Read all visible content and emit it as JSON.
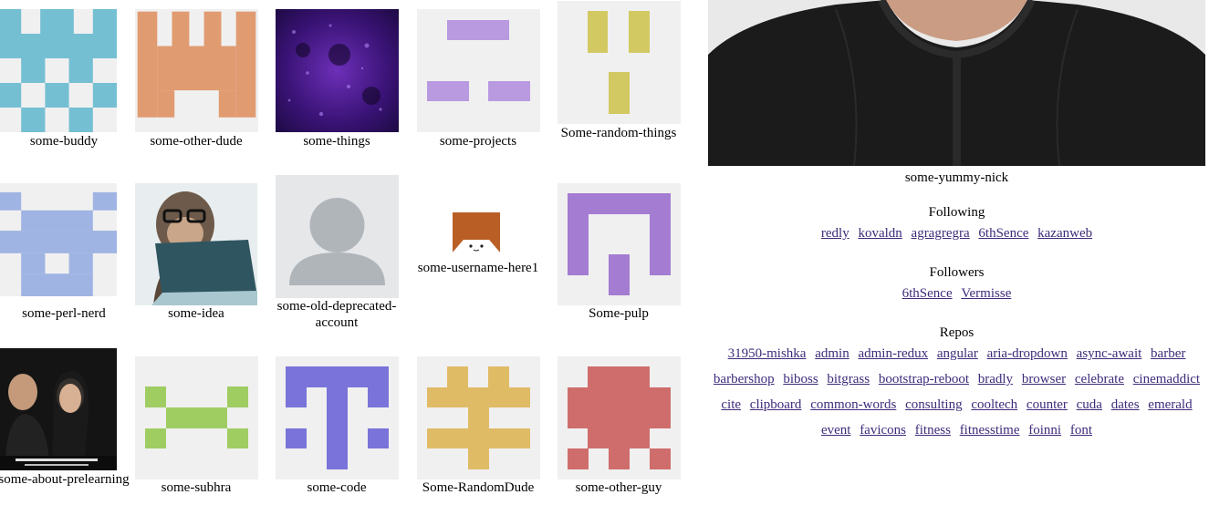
{
  "users": [
    {
      "name": "some-buddy",
      "avatar": "identicon-cyan"
    },
    {
      "name": "some-other-dude",
      "avatar": "identicon-orange"
    },
    {
      "name": "some-things",
      "avatar": "galaxy-photo"
    },
    {
      "name": "some-projects",
      "avatar": "identicon-lavender"
    },
    {
      "name": "Some-random-things",
      "avatar": "identicon-yellow"
    },
    {
      "name": "some-perl-nerd",
      "avatar": "identicon-blue"
    },
    {
      "name": "some-idea",
      "avatar": "gorilla-laptop-cartoon"
    },
    {
      "name": "some-old-deprecated-account",
      "avatar": "default-person-avatar"
    },
    {
      "name": "some-username-here1",
      "avatar": "cat-icon"
    },
    {
      "name": "Some-pulp",
      "avatar": "identicon-purple"
    },
    {
      "name": "some-about-prelearning",
      "avatar": "couple-photo"
    },
    {
      "name": "some-subhra",
      "avatar": "identicon-green"
    },
    {
      "name": "some-code",
      "avatar": "identicon-indigo"
    },
    {
      "name": "Some-RandomDude",
      "avatar": "identicon-gold"
    },
    {
      "name": "some-other-guy",
      "avatar": "identicon-red"
    }
  ],
  "profile": {
    "name": "some-yummy-nick",
    "photo": "person-black-jacket-photo",
    "following_title": "Following",
    "following": [
      "redly",
      "kovaldn",
      "agragregra",
      "6thSence",
      "kazanweb"
    ],
    "followers_title": "Followers",
    "followers": [
      "6thSence",
      "Vermisse"
    ],
    "repos_title": "Repos",
    "repos": [
      "31950-mishka",
      "admin",
      "admin-redux",
      "angular",
      "aria-dropdown",
      "async-await",
      "barber",
      "barbershop",
      "biboss",
      "bitgrass",
      "bootstrap-reboot",
      "bradly",
      "browser",
      "celebrate",
      "cinemaddict",
      "cite",
      "clipboard",
      "common-words",
      "consulting",
      "cooltech",
      "counter",
      "cuda",
      "dates",
      "emerald",
      "event",
      "favicons",
      "fitness",
      "fitnesstime",
      "foinni",
      "font"
    ]
  },
  "colors": {
    "link": "#3f2b7a",
    "tile_bg": "#f0f0f0"
  }
}
